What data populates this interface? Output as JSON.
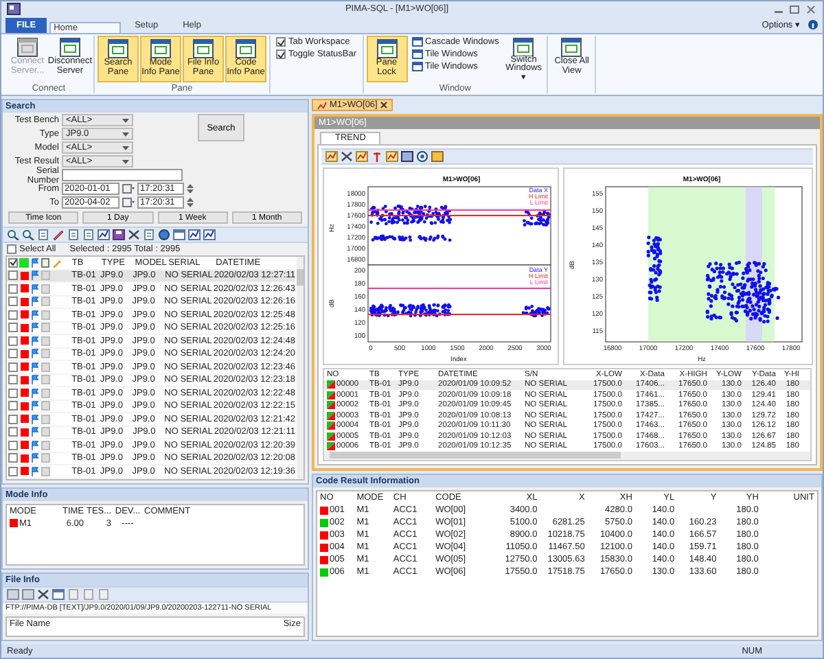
{
  "window": {
    "title": "PIMA-SQL - [M1>WO[06]]"
  },
  "ribbon": {
    "tabs": [
      {
        "label": "FILE",
        "kind": "file",
        "selected": false
      },
      {
        "label": "Home",
        "kind": "tab",
        "selected": true
      },
      {
        "label": "Setup",
        "kind": "tab",
        "selected": false
      },
      {
        "label": "Help",
        "kind": "tab",
        "selected": false
      }
    ],
    "options": "Options ▾",
    "groups": [
      {
        "label": "Connect",
        "items": [
          {
            "kind": "large",
            "label": "Connect Server...",
            "on": false,
            "disabled": true
          },
          {
            "kind": "large",
            "label": "Disconnect Server",
            "on": false,
            "disabled": false
          }
        ]
      },
      {
        "label": "Pane",
        "items": [
          {
            "kind": "large",
            "label": "Search Pane",
            "on": true,
            "disabled": false
          },
          {
            "kind": "large",
            "label": "Mode Info Pane",
            "on": true,
            "disabled": false
          },
          {
            "kind": "large",
            "label": "File Info Pane",
            "on": true,
            "disabled": false
          },
          {
            "kind": "large",
            "label": "Code Info Pane",
            "on": true,
            "disabled": false
          }
        ]
      },
      {
        "items": [
          {
            "kind": "stack",
            "items": [
              {
                "kind": "check",
                "label": "Tab Workspace",
                "checked": true
              },
              {
                "kind": "check",
                "label": "Toggle StatusBar",
                "checked": true
              }
            ]
          }
        ]
      },
      {
        "label": "Window",
        "items": [
          {
            "kind": "large",
            "label": "Pane Lock",
            "on": true,
            "disabled": false
          },
          {
            "kind": "stack",
            "items": [
              {
                "kind": "small",
                "label": "Cascade Windows"
              },
              {
                "kind": "small",
                "label": "Tile Windows"
              },
              {
                "kind": "small",
                "label": "Tile Windows"
              }
            ]
          },
          {
            "kind": "large",
            "label": "Switch Windows ▾",
            "on": false,
            "disabled": false
          }
        ]
      },
      {
        "items": [
          {
            "kind": "large",
            "label": "Close All View",
            "on": false,
            "disabled": false
          }
        ]
      }
    ]
  },
  "search": {
    "title": "Search",
    "fields": [
      {
        "label": "Test Bench",
        "kind": "select",
        "value": "<ALL>"
      },
      {
        "label": "Type",
        "kind": "select",
        "value": "JP9.0"
      },
      {
        "label": "Model",
        "kind": "select",
        "value": "<ALL>"
      },
      {
        "label": "Test Result",
        "kind": "select",
        "value": "<ALL>"
      },
      {
        "label": "Serial Number",
        "kind": "text"
      }
    ],
    "search_button": "Search",
    "dates": [
      {
        "label": "From",
        "date": "2020-01-01",
        "time": "17:20:31"
      },
      {
        "label": "To",
        "date": "2020-04-02",
        "time": "17:20:31"
      }
    ],
    "range_buttons": [
      "Time Icon",
      "1 Day",
      "1 Week",
      "1 Month"
    ],
    "select_all": {
      "label": "Select All",
      "checked": false
    },
    "summary": "Selected : 2995  Total : 2995",
    "header_checkbox": {
      "checked": true
    },
    "columns": [
      "TB",
      "TYPE",
      "MODEL",
      "SERIAL",
      "DATETIME"
    ],
    "rows": [
      {
        "tb": "TB-01",
        "type": "JP9.0",
        "model": "JP9.0",
        "serial": "NO SERIAL",
        "datetime": "2020/02/03 12:27:11",
        "color": "#ff0000",
        "checked": false,
        "selected": true
      },
      {
        "tb": "TB-01",
        "type": "JP9.0",
        "model": "JP9.0",
        "serial": "NO SERIAL",
        "datetime": "2020/02/03 12:26:43",
        "color": "#ff0000",
        "checked": false,
        "selected": false
      },
      {
        "tb": "TB-01",
        "type": "JP9.0",
        "model": "JP9.0",
        "serial": "NO SERIAL",
        "datetime": "2020/02/03 12:26:16",
        "color": "#ff0000",
        "checked": false,
        "selected": false
      },
      {
        "tb": "TB-01",
        "type": "JP9.0",
        "model": "JP9.0",
        "serial": "NO SERIAL",
        "datetime": "2020/02/03 12:25:48",
        "color": "#ff0000",
        "checked": false,
        "selected": false
      },
      {
        "tb": "TB-01",
        "type": "JP9.0",
        "model": "JP9.0",
        "serial": "NO SERIAL",
        "datetime": "2020/02/03 12:25:16",
        "color": "#ff0000",
        "checked": false,
        "selected": false
      },
      {
        "tb": "TB-01",
        "type": "JP9.0",
        "model": "JP9.0",
        "serial": "NO SERIAL",
        "datetime": "2020/02/03 12:24:48",
        "color": "#ff0000",
        "checked": false,
        "selected": false
      },
      {
        "tb": "TB-01",
        "type": "JP9.0",
        "model": "JP9.0",
        "serial": "NO SERIAL",
        "datetime": "2020/02/03 12:24:20",
        "color": "#ff0000",
        "checked": false,
        "selected": false
      },
      {
        "tb": "TB-01",
        "type": "JP9.0",
        "model": "JP9.0",
        "serial": "NO SERIAL",
        "datetime": "2020/02/03 12:23:46",
        "color": "#ff0000",
        "checked": false,
        "selected": false
      },
      {
        "tb": "TB-01",
        "type": "JP9.0",
        "model": "JP9.0",
        "serial": "NO SERIAL",
        "datetime": "2020/02/03 12:23:18",
        "color": "#ff0000",
        "checked": false,
        "selected": false
      },
      {
        "tb": "TB-01",
        "type": "JP9.0",
        "model": "JP9.0",
        "serial": "NO SERIAL",
        "datetime": "2020/02/03 12:22:48",
        "color": "#ff0000",
        "checked": false,
        "selected": false
      },
      {
        "tb": "TB-01",
        "type": "JP9.0",
        "model": "JP9.0",
        "serial": "NO SERIAL",
        "datetime": "2020/02/03 12:22:15",
        "color": "#ff0000",
        "checked": false,
        "selected": false
      },
      {
        "tb": "TB-01",
        "type": "JP9.0",
        "model": "JP9.0",
        "serial": "NO SERIAL",
        "datetime": "2020/02/03 12:21:42",
        "color": "#ff0000",
        "checked": false,
        "selected": false
      },
      {
        "tb": "TB-01",
        "type": "JP9.0",
        "model": "JP9.0",
        "serial": "NO SERIAL",
        "datetime": "2020/02/03 12:21:11",
        "color": "#ff0000",
        "checked": false,
        "selected": false
      },
      {
        "tb": "TB-01",
        "type": "JP9.0",
        "model": "JP9.0",
        "serial": "NO SERIAL",
        "datetime": "2020/02/03 12:20:39",
        "color": "#ff0000",
        "checked": false,
        "selected": false
      },
      {
        "tb": "TB-01",
        "type": "JP9.0",
        "model": "JP9.0",
        "serial": "NO SERIAL",
        "datetime": "2020/02/03 12:20:08",
        "color": "#ff0000",
        "checked": false,
        "selected": false
      },
      {
        "tb": "TB-01",
        "type": "JP9.0",
        "model": "JP9.0",
        "serial": "NO SERIAL",
        "datetime": "2020/02/03 12:19:36",
        "color": "#ff0000",
        "checked": false,
        "selected": false
      }
    ]
  },
  "mode_info": {
    "title": "Mode Info",
    "columns": [
      "MODE",
      "TIME",
      "TES...",
      "DEV...",
      "COMMENT"
    ],
    "rows": [
      {
        "mode": "M1",
        "time": "6.00",
        "tes": "3",
        "dev": "----",
        "color": "#ff0000"
      }
    ]
  },
  "file_info": {
    "title": "File Info",
    "path": "FTP://PIMA-DB [TEXT]/JP9.0/2020/01/09/JP9.0/20200203-122711-NO SERIAL",
    "columns": [
      "File Name",
      "Size"
    ]
  },
  "document": {
    "tab": "M1>WO[06]",
    "title": "M1>WO[06]",
    "inner_tab": "TREND",
    "trend_chart": {
      "title": "M1>WO[06]",
      "x_label": "Index",
      "x_ticks": [
        "0",
        "500",
        "1000",
        "1500",
        "2000",
        "2500",
        "3000"
      ],
      "panels": [
        {
          "y_label": "Hz",
          "y_ticks": [
            "18000",
            "17800",
            "17600",
            "17400",
            "17200",
            "17000",
            "16800"
          ],
          "legend": [
            "Data X",
            "H Limit",
            "L Limit"
          ]
        },
        {
          "y_label": "dB",
          "y_ticks": [
            "200",
            "180",
            "160",
            "140",
            "120",
            "100"
          ],
          "legend": [
            "Data Y",
            "H Limit",
            "L Limit"
          ]
        }
      ]
    },
    "scatter_chart": {
      "title": "M1>WO[06]",
      "x_label": "Hz",
      "y_label": "dB",
      "x_ticks": [
        "16800",
        "17000",
        "17200",
        "17400",
        "17600",
        "17800"
      ],
      "y_ticks": [
        "155",
        "150",
        "145",
        "140",
        "135",
        "130",
        "125",
        "120",
        "115"
      ]
    },
    "columns": [
      "NO",
      "TB",
      "TYPE",
      "DATETIME",
      "S/N",
      "X-LOW",
      "X-Data",
      "X-HIGH",
      "Y-LOW",
      "Y-Data",
      "Y-HI"
    ],
    "rows": [
      [
        "00000",
        "TB-01",
        "JP9.0",
        "2020/01/09 10:09:52",
        "NO SERIAL",
        "17500.0",
        "17406...",
        "17650.0",
        "130.0",
        "126.40",
        "180"
      ],
      [
        "00001",
        "TB-01",
        "JP9.0",
        "2020/01/09 10:09:18",
        "NO SERIAL",
        "17500.0",
        "17461...",
        "17650.0",
        "130.0",
        "129.41",
        "180"
      ],
      [
        "00002",
        "TB-01",
        "JP9.0",
        "2020/01/09 10:09:45",
        "NO SERIAL",
        "17500.0",
        "17385...",
        "17650.0",
        "130.0",
        "124.40",
        "180"
      ],
      [
        "00003",
        "TB-01",
        "JP9.0",
        "2020/01/09 10:08:13",
        "NO SERIAL",
        "17500.0",
        "17427...",
        "17650.0",
        "130.0",
        "129.72",
        "180"
      ],
      [
        "00004",
        "TB-01",
        "JP9.0",
        "2020/01/09 10:11:30",
        "NO SERIAL",
        "17500.0",
        "17463...",
        "17650.0",
        "130.0",
        "126.12",
        "180"
      ],
      [
        "00005",
        "TB-01",
        "JP9.0",
        "2020/01/09 10:12:03",
        "NO SERIAL",
        "17500.0",
        "17468...",
        "17650.0",
        "130.0",
        "126.67",
        "180"
      ],
      [
        "00006",
        "TB-01",
        "JP9.0",
        "2020/01/09 10:12:35",
        "NO SERIAL",
        "17500.0",
        "17603...",
        "17650.0",
        "130.0",
        "124.85",
        "180"
      ]
    ]
  },
  "code_result": {
    "title": "Code Result Information",
    "columns": [
      "NO",
      "MODE",
      "CH",
      "CODE",
      "XL",
      "X",
      "XH",
      "YL",
      "Y",
      "YH",
      "UNIT"
    ],
    "rows": [
      {
        "cells": [
          "001",
          "M1",
          "ACC1",
          "WO[00]",
          "3400.0",
          "",
          "4280.0",
          "140.0",
          "",
          "180.0",
          ""
        ],
        "color": "#ff0000"
      },
      {
        "cells": [
          "002",
          "M1",
          "ACC1",
          "WO[01]",
          "5100.0",
          "6281.25",
          "5750.0",
          "140.0",
          "160.23",
          "180.0",
          ""
        ],
        "color": "#00cc00"
      },
      {
        "cells": [
          "003",
          "M1",
          "ACC1",
          "WO[02]",
          "8900.0",
          "10218.75",
          "10400.0",
          "140.0",
          "166.57",
          "180.0",
          ""
        ],
        "color": "#ff0000"
      },
      {
        "cells": [
          "004",
          "M1",
          "ACC1",
          "WO[04]",
          "11050.0",
          "11467.50",
          "12100.0",
          "140.0",
          "159.71",
          "180.0",
          ""
        ],
        "color": "#ff0000"
      },
      {
        "cells": [
          "005",
          "M1",
          "ACC1",
          "WO[05]",
          "12750.0",
          "13005.63",
          "15830.0",
          "140.0",
          "148.40",
          "180.0",
          ""
        ],
        "color": "#ff0000"
      },
      {
        "cells": [
          "006",
          "M1",
          "ACC1",
          "WO[06]",
          "17550.0",
          "17518.75",
          "17650.0",
          "130.0",
          "133.60",
          "180.0",
          ""
        ],
        "color": "#00cc00"
      }
    ]
  },
  "status_bar": {
    "left": "Ready",
    "right": "NUM"
  }
}
